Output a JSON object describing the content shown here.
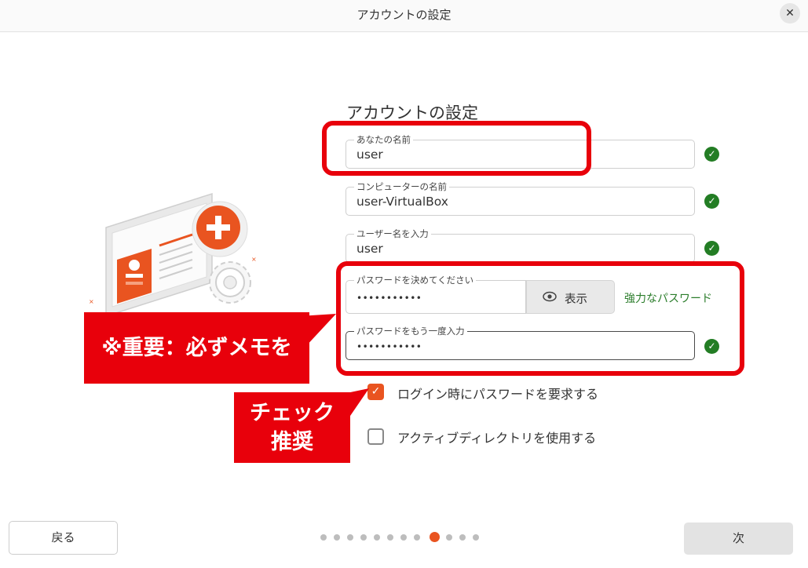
{
  "window": {
    "title": "アカウントの設定",
    "close_label": "✕"
  },
  "form": {
    "heading": "アカウントの設定",
    "fields": [
      {
        "label": "あなたの名前",
        "value": "user"
      },
      {
        "label": "コンピューターの名前",
        "value": "user-VirtualBox"
      },
      {
        "label": "ユーザー名を入力",
        "value": "user"
      },
      {
        "label": "パスワードを決めてください",
        "value": "•••••••••••"
      },
      {
        "label": "パスワードをもう一度入力",
        "value": "•••••••••••"
      }
    ],
    "show_password_label": "表示",
    "password_strength": "強力なパスワード",
    "checkboxes": [
      {
        "label": "ログイン時にパスワードを要求する",
        "checked": true
      },
      {
        "label": "アクティブディレクトリを使用する",
        "checked": false
      }
    ]
  },
  "annotations": {
    "important_note": "※重要：必ずメモを",
    "recommend_line1": "チェック",
    "recommend_line2": "推奨"
  },
  "nav": {
    "back_label": "戻る",
    "next_label": "次",
    "page_count": 11,
    "current_page": 8
  },
  "colors": {
    "accent": "#e95420",
    "success": "#237d24",
    "annotation_red": "#e8000b"
  }
}
